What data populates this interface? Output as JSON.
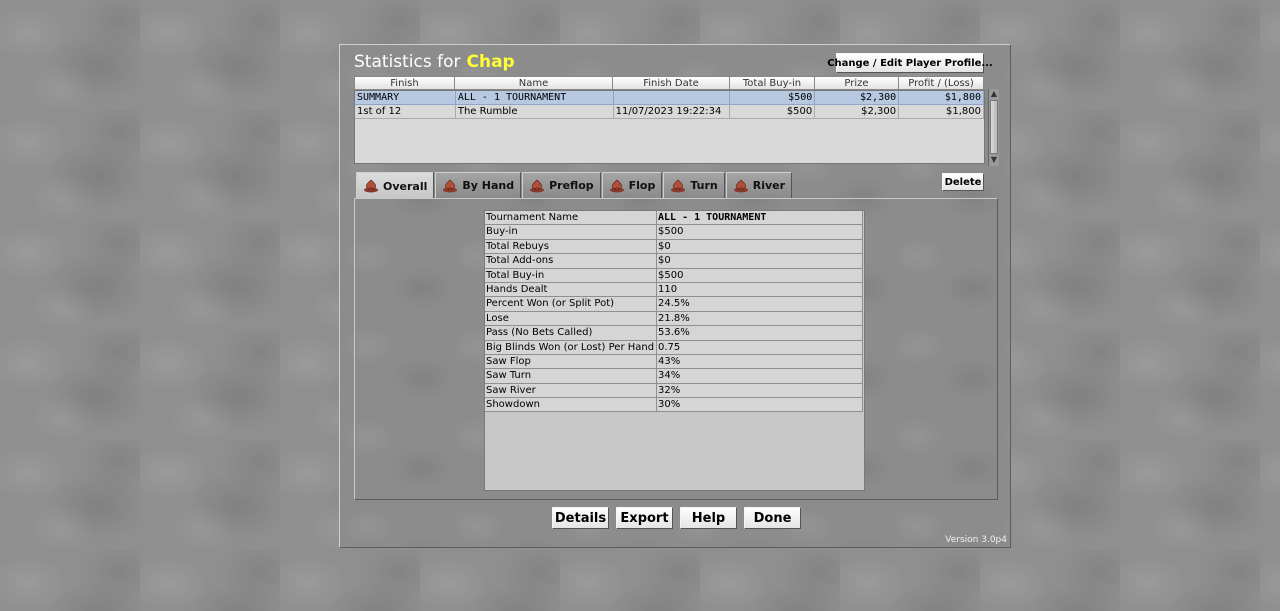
{
  "dialog": {
    "title_prefix": "Statistics for",
    "player_name": "Chap",
    "edit_profile_button": "Change / Edit Player Profile...",
    "delete_button": "Delete",
    "version": "Version 3.0p4"
  },
  "results_table": {
    "columns": [
      "Finish",
      "Name",
      "Finish Date",
      "Total Buy-in",
      "Prize",
      "Profit / (Loss)"
    ],
    "rows": [
      [
        "SUMMARY",
        "ALL - 1 TOURNAMENT",
        "",
        "$500",
        "$2,300",
        "$1,800"
      ],
      [
        "1st of 12",
        "The Rumble",
        "11/07/2023 19:22:34",
        "$500",
        "$2,300",
        "$1,800"
      ]
    ]
  },
  "tabs": [
    {
      "label": "Overall",
      "icon": "spade-chip-icon",
      "active": true
    },
    {
      "label": "By Hand",
      "icon": "spade-chip-icon",
      "active": false
    },
    {
      "label": "Preflop",
      "icon": "spade-chip-icon",
      "active": false
    },
    {
      "label": "Flop",
      "icon": "spade-chip-icon",
      "active": false
    },
    {
      "label": "Turn",
      "icon": "spade-chip-icon",
      "active": false
    },
    {
      "label": "River",
      "icon": "spade-chip-icon",
      "active": false
    }
  ],
  "stats": [
    {
      "label": "Tournament Name",
      "value": "ALL - 1 TOURNAMENT"
    },
    {
      "label": "Buy-in",
      "value": "$500"
    },
    {
      "label": "Total Rebuys",
      "value": "$0"
    },
    {
      "label": "Total Add-ons",
      "value": "$0"
    },
    {
      "label": "Total Buy-in",
      "value": "$500"
    },
    {
      "label": "Hands Dealt",
      "value": "110"
    },
    {
      "label": "Percent Won (or Split Pot)",
      "value": "24.5%"
    },
    {
      "label": "Lose",
      "value": "21.8%"
    },
    {
      "label": "Pass (No Bets Called)",
      "value": "53.6%"
    },
    {
      "label": "Big Blinds Won (or Lost) Per Hand",
      "value": "0.75"
    },
    {
      "label": "Saw Flop",
      "value": "43%"
    },
    {
      "label": "Saw Turn",
      "value": "34%"
    },
    {
      "label": "Saw River",
      "value": "32%"
    },
    {
      "label": "Showdown",
      "value": "30%"
    }
  ],
  "bottom_buttons": {
    "details": "Details",
    "export": "Export",
    "help": "Help",
    "done": "Done"
  },
  "colors": {
    "player_name": "#ffff33",
    "summary_row": "#b6c9e0",
    "icon_chip": "#b0503a"
  }
}
